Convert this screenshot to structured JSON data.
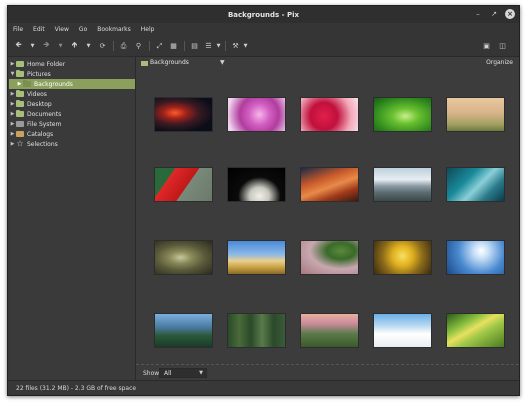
{
  "window": {
    "title": "Backgrounds - Pix"
  },
  "menubar": {
    "items": [
      "File",
      "Edit",
      "View",
      "Go",
      "Bookmarks",
      "Help"
    ]
  },
  "sidebar": {
    "items": [
      {
        "label": "Home Folder",
        "icon": "home-folder-icon"
      },
      {
        "label": "Pictures",
        "icon": "folder-icon"
      },
      {
        "label": "Backgrounds",
        "icon": "folder-icon",
        "selected": true
      },
      {
        "label": "Videos",
        "icon": "folder-icon"
      },
      {
        "label": "Desktop",
        "icon": "folder-icon"
      },
      {
        "label": "Documents",
        "icon": "folder-icon"
      },
      {
        "label": "File System",
        "icon": "drive-icon"
      },
      {
        "label": "Catalogs",
        "icon": "catalog-icon"
      },
      {
        "label": "Selections",
        "icon": "star-icon"
      }
    ]
  },
  "location": {
    "folder": "Backgrounds",
    "organize_label": "Organize"
  },
  "filter": {
    "label": "Show:",
    "value": "All"
  },
  "status": {
    "text": "22 files (31.2 MB) - 2.3 GB of free space"
  },
  "colors": {
    "selection": "#8aa05c",
    "folder": "#a8bf7a",
    "window_bg": "#383838"
  }
}
